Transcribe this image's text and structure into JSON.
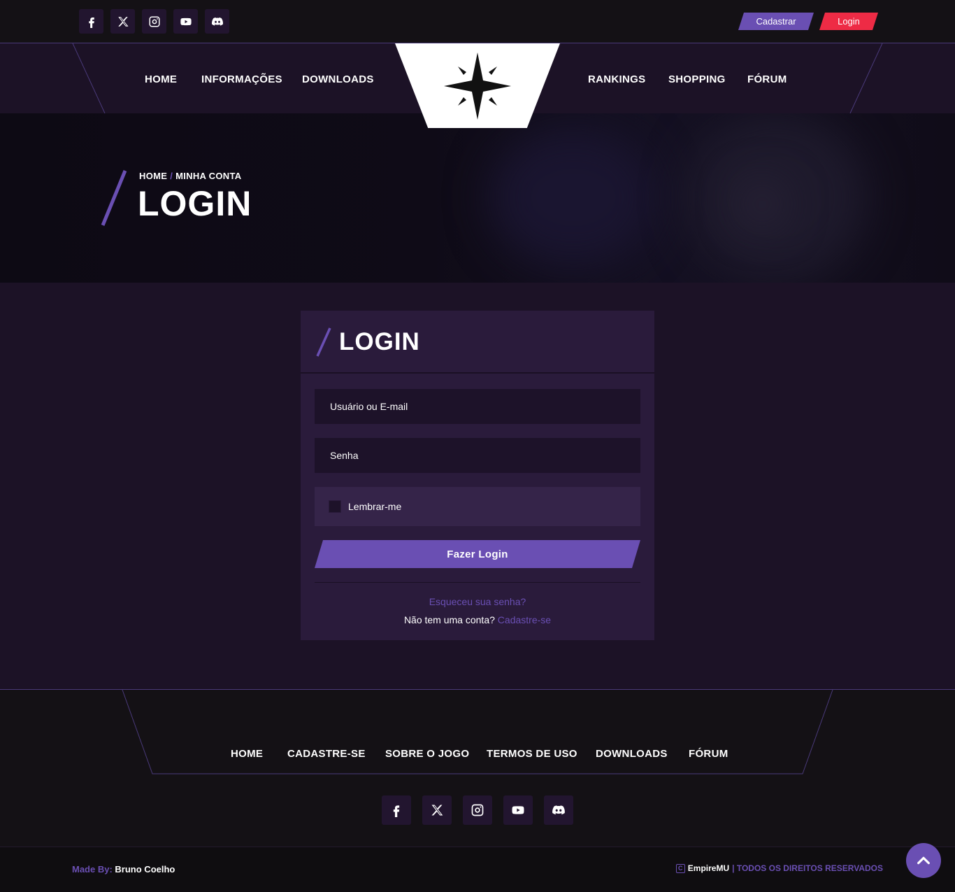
{
  "topbar": {
    "social": [
      "facebook-icon",
      "x-twitter-icon",
      "instagram-icon",
      "youtube-icon",
      "discord-icon"
    ],
    "register_label": "Cadastrar",
    "login_label": "Login"
  },
  "nav": {
    "left": [
      "HOME",
      "INFORMAÇÕES",
      "DOWNLOADS"
    ],
    "right": [
      "RANKINGS",
      "SHOPPING",
      "FÓRUM"
    ],
    "logo_icon": "compass-star-icon"
  },
  "hero": {
    "breadcrumb_home": "HOME",
    "breadcrumb_sep": "/",
    "breadcrumb_current": "MINHA CONTA",
    "title": "LOGIN"
  },
  "login_card": {
    "title": "LOGIN",
    "username_placeholder": "Usuário ou E-mail",
    "password_placeholder": "Senha",
    "remember_label": "Lembrar-me",
    "submit_label": "Fazer Login",
    "forgot_label": "Esqueceu sua senha?",
    "no_account_text": "Não tem uma conta?",
    "signup_link": "Cadastre-se"
  },
  "footer": {
    "nav": [
      "HOME",
      "CADASTRE-SE",
      "SOBRE O JOGO",
      "TERMOS DE USO",
      "DOWNLOADS",
      "FÓRUM"
    ],
    "social": [
      "facebook-icon",
      "x-twitter-icon",
      "instagram-icon",
      "youtube-icon",
      "discord-icon"
    ]
  },
  "bottom": {
    "made_by_label": "Made By:",
    "made_by_name": "Bruno Coelho",
    "brand": "EmpireMU",
    "rights": "| TODOS OS DIREITOS RESERVADOS"
  },
  "colors": {
    "accent": "#6a4fb3",
    "login_red": "#ee2b45",
    "background": "#1c1226",
    "card": "#2a1b3b",
    "dark_bar": "#141115"
  }
}
